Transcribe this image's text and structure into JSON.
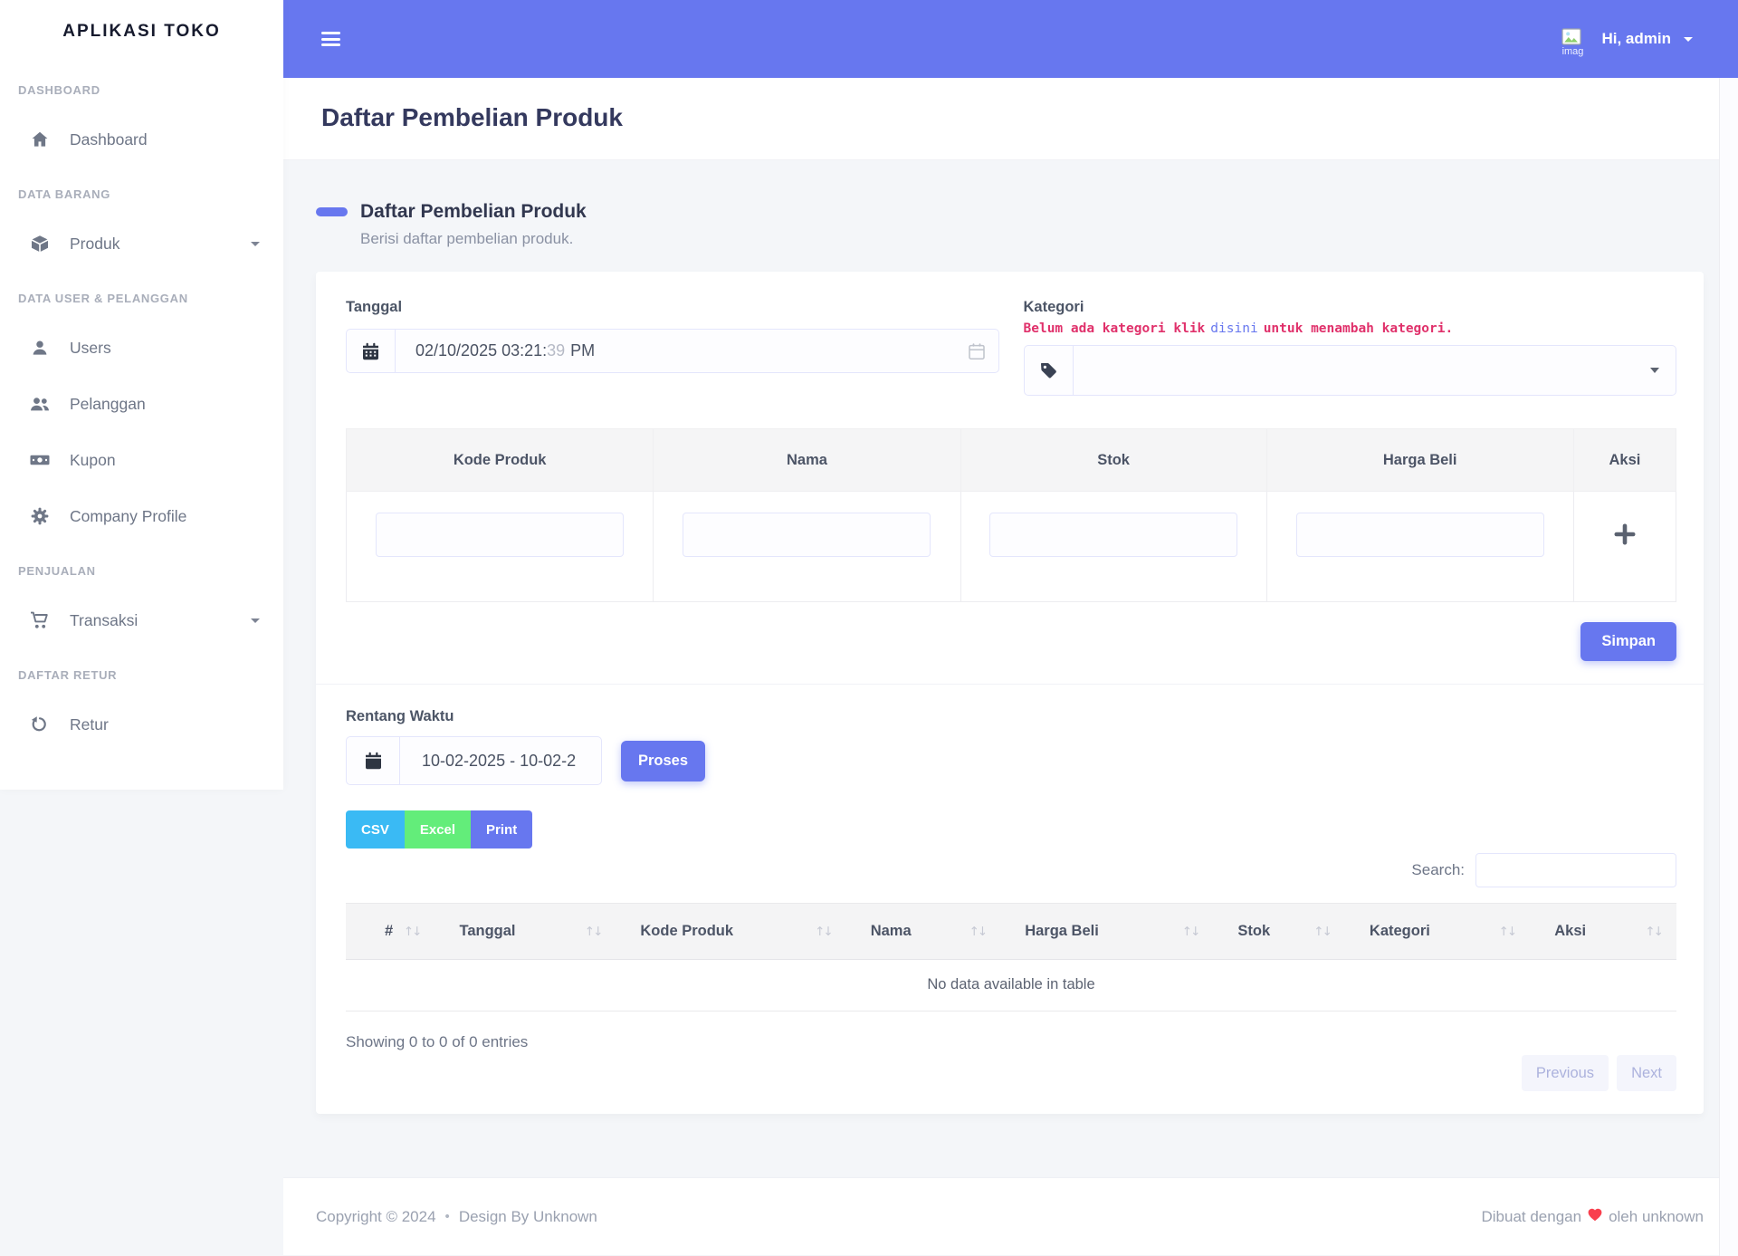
{
  "colors": {
    "primary": "#6777ef",
    "info": "#3abaf4",
    "success": "#63ed7a",
    "danger": "#e0316b",
    "link": "#6777ef",
    "heart": "#f9404e"
  },
  "sidebar": {
    "brand": "APLIKASI TOKO",
    "sections": [
      {
        "label": "DASHBOARD",
        "items": [
          {
            "icon": "home-icon",
            "label": "Dashboard"
          }
        ]
      },
      {
        "label": "DATA BARANG",
        "items": [
          {
            "icon": "box-icon",
            "label": "Produk",
            "has_submenu": true
          }
        ]
      },
      {
        "label": "DATA USER & PELANGGAN",
        "items": [
          {
            "icon": "user-icon",
            "label": "Users"
          },
          {
            "icon": "users-icon",
            "label": "Pelanggan"
          },
          {
            "icon": "money-icon",
            "label": "Kupon"
          },
          {
            "icon": "gear-icon",
            "label": "Company Profile"
          }
        ]
      },
      {
        "label": "PENJUALAN",
        "items": [
          {
            "icon": "cart-icon",
            "label": "Transaksi",
            "has_submenu": true
          }
        ]
      },
      {
        "label": "DAFTAR RETUR",
        "items": [
          {
            "icon": "undo-icon",
            "label": "Retur"
          }
        ]
      }
    ]
  },
  "navbar": {
    "greeting": "Hi, admin",
    "avatar_alt": "imag"
  },
  "page": {
    "title": "Daftar Pembelian Produk"
  },
  "section": {
    "title": "Daftar Pembelian Produk",
    "description": "Berisi daftar pembelian produk."
  },
  "purchase_form": {
    "tanggal_label": "Tanggal",
    "tanggal_value": {
      "datetime": "02/10/2025 03:21:",
      "seconds": "39",
      "meridiem": "PM"
    },
    "kategori_label": "Kategori",
    "kategori_note": {
      "pre": "Belum ada kategori klik",
      "link": "disini",
      "post": "untuk menambah kategori."
    },
    "table_headers": [
      "Kode Produk",
      "Nama",
      "Stok",
      "Harga Beli",
      "Aksi"
    ],
    "submit_label": "Simpan"
  },
  "list_section": {
    "rentang_label": "Rentang Waktu",
    "rentang_value": "10-02-2025 - 10-02-2",
    "proses_label": "Proses",
    "export_buttons": [
      "CSV",
      "Excel",
      "Print"
    ],
    "search_label": "Search:",
    "sort_icon": "↑↓",
    "table_headers": [
      "#",
      "Tanggal",
      "Kode Produk",
      "Nama",
      "Harga Beli",
      "Stok",
      "Kategori",
      "Aksi"
    ],
    "empty_text": "No data available in table",
    "showing_text": "Showing 0 to 0 of 0 entries",
    "prev_label": "Previous",
    "next_label": "Next"
  },
  "footer": {
    "copyright": "Copyright © 2024",
    "bullet": "•",
    "design": "Design By Unknown",
    "made_pre": "Dibuat dengan",
    "made_post": "oleh unknown"
  }
}
